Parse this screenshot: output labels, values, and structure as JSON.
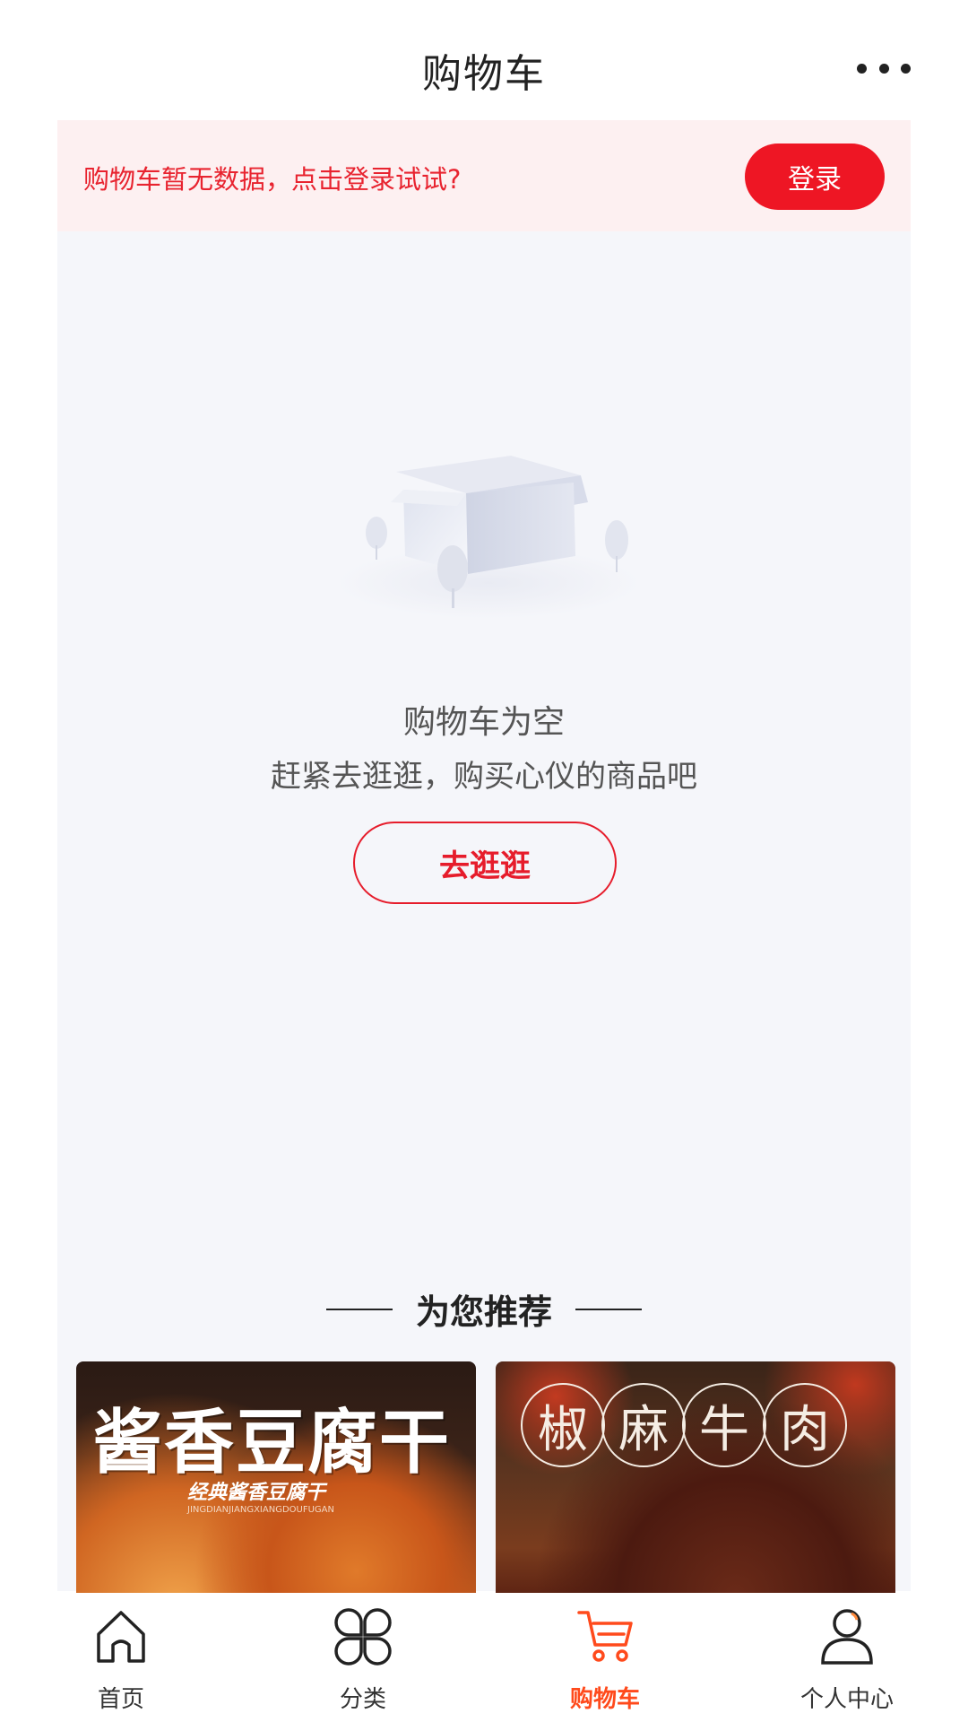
{
  "header": {
    "title": "购物车"
  },
  "login_banner": {
    "tip": "购物车暂无数据，点击登录试试?",
    "button_label": "登录"
  },
  "empty_state": {
    "title": "购物车为空",
    "subtitle": "赶紧去逛逛，购买心仪的商品吧",
    "button_label": "去逛逛"
  },
  "recommend": {
    "title": "为您推荐",
    "products": [
      {
        "title_text": "酱香豆腐干",
        "subtitle_text": "经典酱香豆腐干",
        "pinyin_text": "JINGDIANJIANGXIANGDOUFUGAN"
      },
      {
        "title_chars": [
          "椒",
          "麻",
          "牛",
          "肉"
        ]
      }
    ]
  },
  "tabbar": {
    "tabs": [
      {
        "label": "首页",
        "icon": "home-icon",
        "active": false
      },
      {
        "label": "分类",
        "icon": "category-icon",
        "active": false
      },
      {
        "label": "购物车",
        "icon": "cart-icon",
        "active": true
      },
      {
        "label": "个人中心",
        "icon": "user-icon",
        "active": false
      }
    ]
  },
  "colors": {
    "accent_red": "#ee1624",
    "active_tab_orange": "#ff4a1c",
    "banner_bg": "#fdf0f1",
    "panel_bg": "#f5f6fa"
  }
}
